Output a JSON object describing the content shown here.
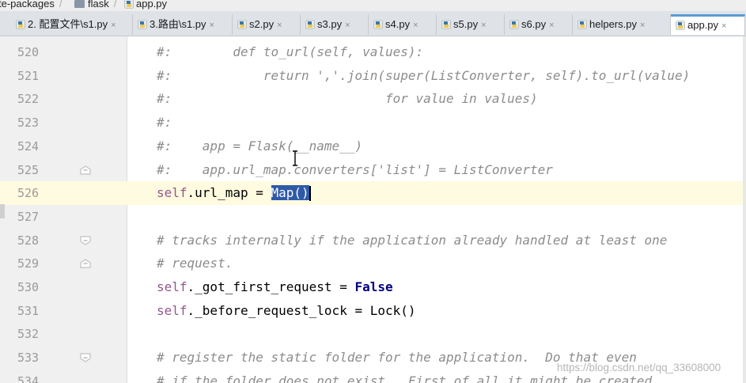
{
  "breadcrumb": [
    {
      "label": "te-packages",
      "icon": "none"
    },
    {
      "label": "flask",
      "icon": "folder-icon"
    },
    {
      "label": "app.py",
      "icon": "python-file-icon"
    }
  ],
  "tabs": [
    {
      "label": "2. 配置文件\\s1.py",
      "active": false
    },
    {
      "label": "3.路由\\s1.py",
      "active": false
    },
    {
      "label": "s2.py",
      "active": false
    },
    {
      "label": "s3.py",
      "active": false
    },
    {
      "label": "s4.py",
      "active": false
    },
    {
      "label": "s5.py",
      "active": false
    },
    {
      "label": "s6.py",
      "active": false
    },
    {
      "label": "helpers.py",
      "active": false
    },
    {
      "label": "app.py",
      "active": true
    }
  ],
  "tab_close_glyph": "×",
  "editor": {
    "current_line": "526",
    "lines": [
      {
        "num": "520",
        "parts": [
          {
            "t": "#:        def to_url(self, values):",
            "c": "cm"
          }
        ]
      },
      {
        "num": "521",
        "parts": [
          {
            "t": "#:            return ','.join(super(ListConverter, self).to_url(value)",
            "c": "cm"
          }
        ]
      },
      {
        "num": "522",
        "parts": [
          {
            "t": "#:                            for value in values)",
            "c": "cm"
          }
        ]
      },
      {
        "num": "523",
        "parts": [
          {
            "t": "#:",
            "c": "cm"
          }
        ]
      },
      {
        "num": "524",
        "parts": [
          {
            "t": "#:    app = Flask(__name__)",
            "c": "cm"
          }
        ]
      },
      {
        "num": "525",
        "parts": [
          {
            "t": "#:    app.url_map.converters['list'] = ListConverter",
            "c": "cm"
          }
        ]
      },
      {
        "num": "526",
        "parts": [
          {
            "t": "self",
            "c": "slf"
          },
          {
            "t": ".url_map = ",
            "c": "n"
          },
          {
            "t": "Map()",
            "c": "sel"
          }
        ]
      },
      {
        "num": "527",
        "parts": []
      },
      {
        "num": "528",
        "parts": [
          {
            "t": "# tracks internally if the application already handled at least one",
            "c": "cm"
          }
        ]
      },
      {
        "num": "529",
        "parts": [
          {
            "t": "# request.",
            "c": "cm"
          }
        ]
      },
      {
        "num": "530",
        "parts": [
          {
            "t": "self",
            "c": "slf"
          },
          {
            "t": "._got_first_request = ",
            "c": "n"
          },
          {
            "t": "False",
            "c": "kw"
          }
        ]
      },
      {
        "num": "531",
        "parts": [
          {
            "t": "self",
            "c": "slf"
          },
          {
            "t": "._before_request_lock = Lock()",
            "c": "n"
          }
        ]
      },
      {
        "num": "532",
        "parts": []
      },
      {
        "num": "533",
        "parts": [
          {
            "t": "# register the static folder for the application.  Do that even",
            "c": "cm"
          }
        ]
      },
      {
        "num": "534",
        "parts": [
          {
            "t": "# if the folder does not exist.  First of all it might be created",
            "c": "cm"
          }
        ]
      }
    ],
    "fold_markers": [
      {
        "line": "525",
        "kind": "fold-end-icon"
      },
      {
        "line": "528",
        "kind": "fold-start-icon"
      },
      {
        "line": "529",
        "kind": "fold-end-icon"
      },
      {
        "line": "533",
        "kind": "fold-start-icon"
      }
    ]
  },
  "watermark": "https://blog.csdn.net/qq_33608000",
  "colors": {
    "comment": "#8c8c8c",
    "self": "#94558d",
    "keyword": "#000080",
    "selection": "#2f5aa8",
    "current_line": "#fffbe0",
    "active_tab_accent": "#5b9bd5"
  }
}
